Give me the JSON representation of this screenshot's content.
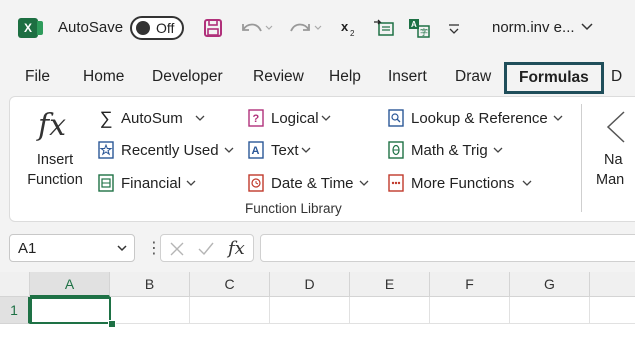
{
  "titlebar": {
    "autosave_label": "AutoSave",
    "autosave_state": "Off",
    "doc_title": "norm.inv e..."
  },
  "tabs": [
    "File",
    "Home",
    "Developer",
    "Review",
    "Help",
    "Insert",
    "Draw",
    "Formulas",
    "D"
  ],
  "active_tab": "Formulas",
  "ribbon": {
    "insert_function": [
      "Insert",
      "Function"
    ],
    "insert_function_glyph": "fx",
    "col1": [
      "AutoSum",
      "Recently Used",
      "Financial"
    ],
    "col2": [
      "Logical",
      "Text",
      "Date & Time"
    ],
    "col3": [
      "Lookup & Reference",
      "Math & Trig",
      "More Functions"
    ],
    "group_label": "Function Library",
    "name_manager": [
      "Na",
      "Man"
    ]
  },
  "formula_bar": {
    "name_box": "A1",
    "fx_glyph": "fx",
    "formula": ""
  },
  "grid": {
    "columns": [
      "A",
      "B",
      "C",
      "D",
      "E",
      "F",
      "G"
    ],
    "rows": [
      "1"
    ],
    "active_cell": "A1"
  },
  "colors": {
    "excel_green": "#1e7145",
    "active_tab_border": "#1f4e5a",
    "qat_save": "#b0307a"
  }
}
